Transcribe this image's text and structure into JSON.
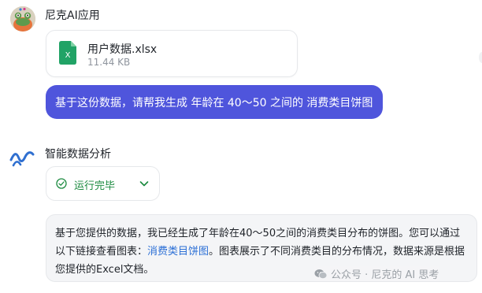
{
  "user": {
    "name": "尼克AI应用"
  },
  "file": {
    "name": "用户数据.xlsx",
    "size": "11.44 KB",
    "icon": "excel-file-icon",
    "icon_letter": "X",
    "color": "#21a366"
  },
  "user_message": "基于这份数据，请帮我生成 年龄在 40～50 之间的 消费类目饼图",
  "assistant": {
    "name": "智能数据分析"
  },
  "status": {
    "label": "运行完毕",
    "color": "#1b8a3f"
  },
  "answer": {
    "part1": "基于您提供的数据，我已经生成了年龄在40～50之间的消费类目分布的饼图。您可以通过以下链接查看图表：",
    "link": "消费类目饼图",
    "part2": "。图表展示了不同消费类目的分布情况，数据来源是根据您提供的Excel文档。"
  },
  "watermark": {
    "text": "公众号 · 尼克的 AI 思考"
  },
  "colors": {
    "bubble": "#4f55dc",
    "link": "#2b6fd6",
    "answer_bg": "#f4f5f7"
  }
}
